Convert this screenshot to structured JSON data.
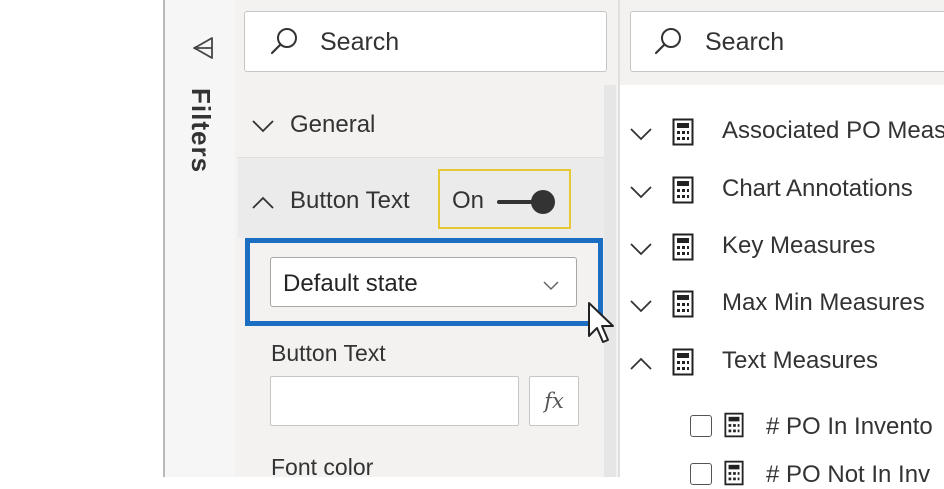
{
  "filters_pane": {
    "label": "Filters",
    "icon": "collapse-arrow-icon"
  },
  "format_pane": {
    "search": {
      "placeholder": "Search",
      "icon": "search-icon"
    },
    "sections": {
      "general": {
        "label": "General",
        "expanded": false
      },
      "button_text": {
        "label": "Button Text",
        "expanded": true,
        "toggle": {
          "label": "On",
          "state": true
        }
      }
    },
    "state_dropdown": {
      "value": "Default state"
    },
    "button_text_field": {
      "label": "Button Text",
      "value": "",
      "fx_label": "fx"
    },
    "font_color": {
      "label": "Font color"
    }
  },
  "fields_pane": {
    "search": {
      "placeholder": "Search",
      "icon": "search-icon"
    },
    "tables": [
      {
        "label": "Associated PO Meas",
        "expanded": false
      },
      {
        "label": "Chart Annotations",
        "expanded": false
      },
      {
        "label": "Key Measures",
        "expanded": false
      },
      {
        "label": "Max Min Measures",
        "expanded": false
      },
      {
        "label": "Text Measures",
        "expanded": true
      }
    ],
    "measures": [
      {
        "label": "# PO In Invento",
        "checked": false
      },
      {
        "label": "# PO Not In Inv",
        "checked": false
      }
    ]
  },
  "colors": {
    "highlight_border": "#1b6ec2",
    "toggle_highlight": "#e8c735",
    "pane_background": "#f3f2f1"
  }
}
